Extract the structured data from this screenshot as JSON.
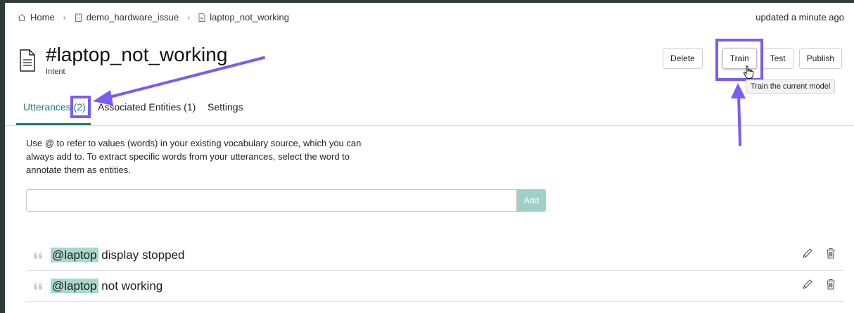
{
  "breadcrumb": {
    "items": [
      {
        "label": "Home",
        "icon": "home-icon"
      },
      {
        "label": "demo_hardware_issue",
        "icon": "building-icon"
      },
      {
        "label": "laptop_not_working",
        "icon": "document-icon"
      }
    ]
  },
  "status": {
    "updated": "updated a minute ago"
  },
  "header": {
    "title": "#laptop_not_working",
    "subtitle": "Intent",
    "icon": "document-icon"
  },
  "actions": {
    "delete_label": "Delete",
    "train_label": "Train",
    "test_label": "Test",
    "publish_label": "Publish",
    "train_tooltip": "Train the current model"
  },
  "tabs": [
    {
      "label": "Utterances",
      "count": "(2)",
      "active": true
    },
    {
      "label": "Associated Entities (1)",
      "active": false
    },
    {
      "label": "Settings",
      "active": false
    }
  ],
  "help_text": "Use @ to refer to values (words) in your existing vocabulary source, which you can always add to. To extract specific words from your utterances, select the word to annotate them as entities.",
  "input": {
    "value": "",
    "placeholder": "",
    "add_label": "Add"
  },
  "utterances": [
    {
      "entity": "@laptop",
      "text": " display stopped"
    },
    {
      "entity": "@laptop",
      "text": " not working"
    }
  ],
  "colors": {
    "accent": "#1f7a7a",
    "highlight": "#7b5cf0",
    "entity_tag": "#a8d8cc",
    "add_button": "#9fcfc6"
  }
}
